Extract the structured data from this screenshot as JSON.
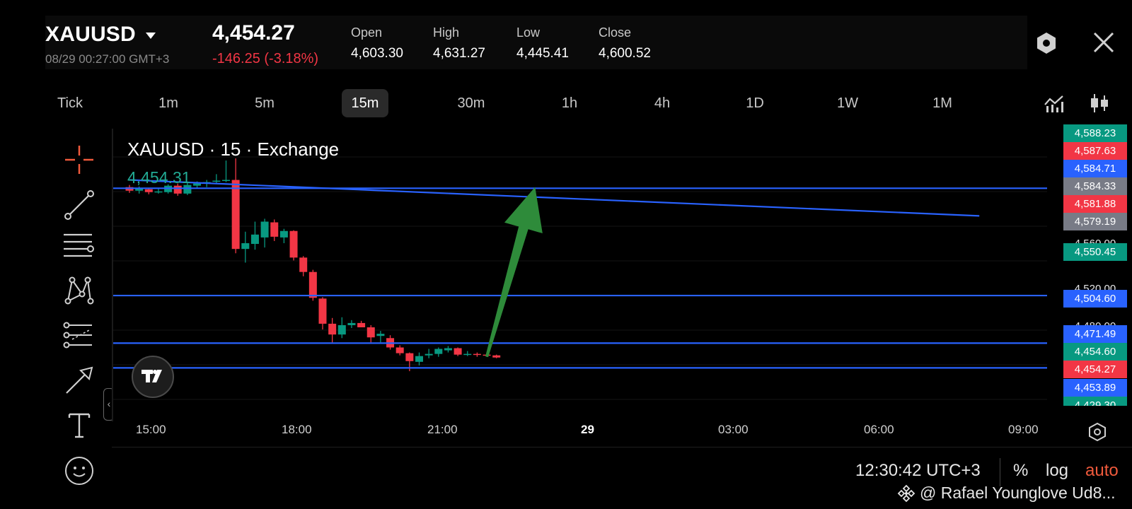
{
  "header": {
    "symbol": "XAUUSD",
    "datetime": "08/29 00:27:00 GMT+3",
    "last_price": "4,454.27",
    "change": "-146.25 (-3.18%)",
    "ohlc": [
      {
        "label": "Open",
        "value": "4,603.30"
      },
      {
        "label": "High",
        "value": "4,631.27"
      },
      {
        "label": "Low",
        "value": "4,445.41"
      },
      {
        "label": "Close",
        "value": "4,600.52"
      }
    ]
  },
  "intervals": [
    "Tick",
    "1m",
    "5m",
    "15m",
    "30m",
    "1h",
    "4h",
    "1D",
    "1W",
    "1M"
  ],
  "active_interval": "15m",
  "icons": {
    "settings": "hexagon-settings-icon",
    "close": "close-icon",
    "indicators": "indicators-icon",
    "chart_type": "candlestick-chart-type-icon",
    "tools": [
      "crosshair-icon",
      "trend-line-icon",
      "horizontal-lines-icon",
      "pattern-icon",
      "forecast-icon",
      "arrow-icon",
      "text-icon",
      "emoji-icon"
    ]
  },
  "chart": {
    "title": "XAUUSD · 15 · Exchange",
    "current_price": "4,454.31",
    "logo": "TV"
  },
  "price_axis": {
    "tags": [
      {
        "value": "4,588.23",
        "color": "#089981"
      },
      {
        "value": "4,587.63",
        "color": "#f23645"
      },
      {
        "value": "4,584.71",
        "color": "#2962ff"
      },
      {
        "value": "4,584.33",
        "color": "#787b86"
      },
      {
        "value": "4,581.88",
        "color": "#f23645"
      },
      {
        "value": "4,579.19",
        "color": "#787b86"
      },
      {
        "value": "4,550.45",
        "color": "#089981"
      },
      {
        "value": "4,504.60",
        "color": "#2962ff"
      },
      {
        "value": "4,471.49",
        "color": "#2962ff"
      },
      {
        "value": "4,454.60",
        "color": "#089981"
      },
      {
        "value": "4,454.27",
        "color": "#f23645"
      },
      {
        "value": "4,453.89",
        "color": "#2962ff"
      },
      {
        "value": "4,429.30",
        "color": "#089981"
      }
    ],
    "ticks": [
      "4,560.00",
      "4,520.00",
      "4,480.00"
    ]
  },
  "time_axis": [
    "15:00",
    "18:00",
    "21:00",
    "29",
    "03:00",
    "06:00",
    "09:00"
  ],
  "footer": {
    "clock": "12:30:42 UTC+3",
    "percent": "%",
    "log": "log",
    "auto": "auto",
    "watermark": "@ Rafael Younglove Ud8..."
  },
  "colors": {
    "up": "#089981",
    "down": "#f23645",
    "line": "#2962ff",
    "arrow": "#2e8b3a",
    "auto": "#f05a3c"
  },
  "chart_data": {
    "type": "candlestick",
    "title": "XAUUSD · 15 · Exchange",
    "timeframe": "15",
    "x_ticks": [
      "15:00",
      "18:00",
      "21:00",
      "29",
      "03:00",
      "06:00",
      "09:00"
    ],
    "y_ticks": [
      4560,
      4520,
      4480
    ],
    "ylim": [
      4424,
      4600
    ],
    "candles": [
      {
        "t": 0,
        "o": 4580.0,
        "h": 4581.5,
        "l": 4576.0,
        "c": 4577.5
      },
      {
        "t": 1,
        "o": 4577.5,
        "h": 4580.5,
        "l": 4575.5,
        "c": 4579.0
      },
      {
        "t": 2,
        "o": 4578.5,
        "h": 4579.5,
        "l": 4575.0,
        "c": 4576.5
      },
      {
        "t": 3,
        "o": 4577.0,
        "h": 4579.0,
        "l": 4575.5,
        "c": 4577.0
      },
      {
        "t": 4,
        "o": 4576.5,
        "h": 4582.0,
        "l": 4575.5,
        "c": 4581.0
      },
      {
        "t": 5,
        "o": 4581.0,
        "h": 4582.5,
        "l": 4574.0,
        "c": 4575.5
      },
      {
        "t": 6,
        "o": 4575.5,
        "h": 4583.0,
        "l": 4574.5,
        "c": 4581.5
      },
      {
        "t": 7,
        "o": 4581.0,
        "h": 4584.0,
        "l": 4579.5,
        "c": 4582.5
      },
      {
        "t": 8,
        "o": 4582.5,
        "h": 4585.0,
        "l": 4580.0,
        "c": 4583.5
      },
      {
        "t": 9,
        "o": 4584.0,
        "h": 4589.0,
        "l": 4583.0,
        "c": 4584.5
      },
      {
        "t": 10,
        "o": 4584.5,
        "h": 4598.5,
        "l": 4583.5,
        "c": 4585.0
      },
      {
        "t": 11,
        "o": 4585.0,
        "h": 4600.0,
        "l": 4534.0,
        "c": 4537.0
      },
      {
        "t": 12,
        "o": 4537.0,
        "h": 4549.0,
        "l": 4527.5,
        "c": 4541.0
      },
      {
        "t": 13,
        "o": 4540.5,
        "h": 4556.0,
        "l": 4536.5,
        "c": 4547.0
      },
      {
        "t": 14,
        "o": 4545.0,
        "h": 4558.0,
        "l": 4538.0,
        "c": 4556.0
      },
      {
        "t": 15,
        "o": 4555.5,
        "h": 4557.5,
        "l": 4542.5,
        "c": 4545.5
      },
      {
        "t": 16,
        "o": 4545.0,
        "h": 4551.0,
        "l": 4541.0,
        "c": 4549.5
      },
      {
        "t": 17,
        "o": 4549.5,
        "h": 4550.0,
        "l": 4529.0,
        "c": 4531.0
      },
      {
        "t": 18,
        "o": 4531.0,
        "h": 4532.0,
        "l": 4518.0,
        "c": 4521.0
      },
      {
        "t": 19,
        "o": 4521.0,
        "h": 4522.5,
        "l": 4501.0,
        "c": 4503.0
      },
      {
        "t": 20,
        "o": 4502.5,
        "h": 4503.5,
        "l": 4481.0,
        "c": 4485.0
      },
      {
        "t": 21,
        "o": 4485.0,
        "h": 4489.0,
        "l": 4472.0,
        "c": 4477.5
      },
      {
        "t": 22,
        "o": 4477.5,
        "h": 4489.5,
        "l": 4475.0,
        "c": 4484.0
      },
      {
        "t": 23,
        "o": 4484.0,
        "h": 4487.5,
        "l": 4482.0,
        "c": 4485.5
      },
      {
        "t": 24,
        "o": 4485.5,
        "h": 4487.0,
        "l": 4482.5,
        "c": 4482.5
      },
      {
        "t": 25,
        "o": 4482.5,
        "h": 4484.0,
        "l": 4472.0,
        "c": 4475.5
      },
      {
        "t": 26,
        "o": 4476.5,
        "h": 4480.0,
        "l": 4472.0,
        "c": 4478.0
      },
      {
        "t": 27,
        "o": 4475.0,
        "h": 4477.0,
        "l": 4467.0,
        "c": 4468.5
      },
      {
        "t": 28,
        "o": 4468.5,
        "h": 4470.0,
        "l": 4463.0,
        "c": 4464.5
      },
      {
        "t": 29,
        "o": 4464.5,
        "h": 4465.0,
        "l": 4452.0,
        "c": 4459.0
      },
      {
        "t": 30,
        "o": 4458.5,
        "h": 4465.0,
        "l": 4456.0,
        "c": 4462.5
      },
      {
        "t": 31,
        "o": 4463.0,
        "h": 4467.5,
        "l": 4461.0,
        "c": 4464.0
      },
      {
        "t": 32,
        "o": 4464.0,
        "h": 4468.5,
        "l": 4462.0,
        "c": 4467.5
      },
      {
        "t": 33,
        "o": 4466.5,
        "h": 4469.5,
        "l": 4465.0,
        "c": 4468.0
      },
      {
        "t": 34,
        "o": 4468.0,
        "h": 4468.5,
        "l": 4462.5,
        "c": 4463.5
      },
      {
        "t": 35,
        "o": 4463.5,
        "h": 4466.0,
        "l": 4462.5,
        "c": 4464.0
      },
      {
        "t": 36,
        "o": 4464.0,
        "h": 4465.0,
        "l": 4462.0,
        "c": 4463.5
      },
      {
        "t": 37,
        "o": 4463.5,
        "h": 4464.5,
        "l": 4462.0,
        "c": 4463.0
      },
      {
        "t": 38,
        "o": 4463.0,
        "h": 4463.5,
        "l": 4461.0,
        "c": 4461.5
      }
    ],
    "horizontal_lines": [
      4579.2,
      4504.6,
      4471.5,
      4454.3
    ],
    "trend_line": {
      "from": {
        "t": 0,
        "price": 4585.0
      },
      "to": {
        "t": 88,
        "price": 4560.0
      }
    },
    "arrow": {
      "from": {
        "t": 37,
        "price": 4462
      },
      "to": {
        "t": 42,
        "price": 4580
      }
    }
  }
}
